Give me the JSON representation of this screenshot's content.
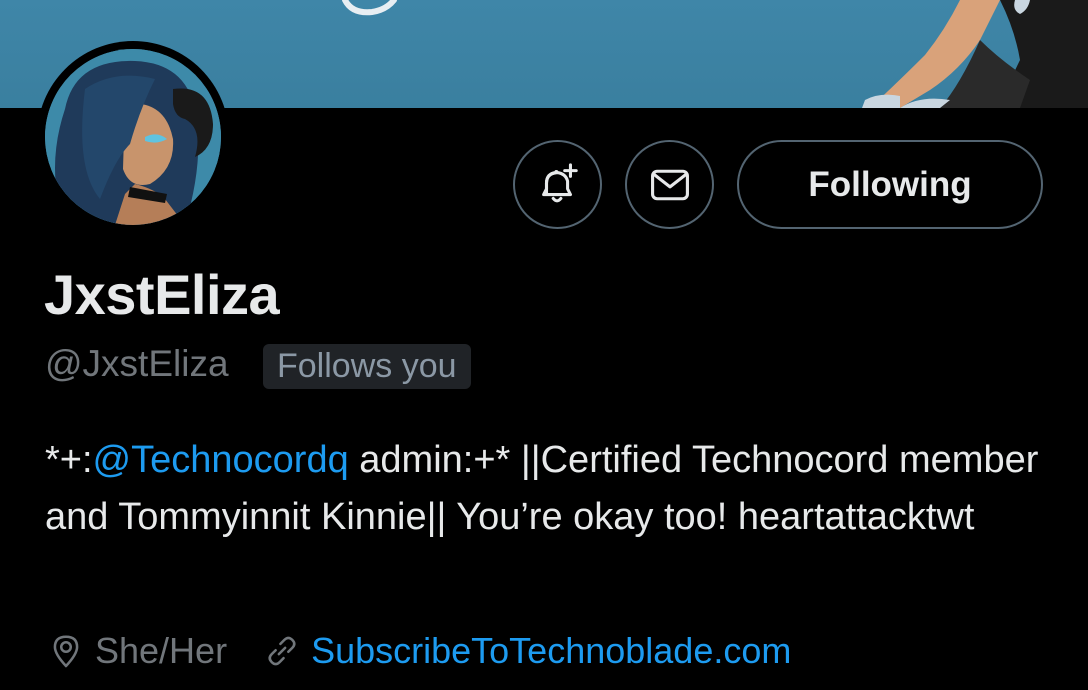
{
  "profile": {
    "display_name": "JxstEliza",
    "handle": "@JxstEliza",
    "follows_you_badge": "Follows you",
    "bio": {
      "prefix": "*+:",
      "mention": "@Technocordq",
      "rest": " admin:+* ||Certified Technocord member and Tommyinnit Kinnie|| You’re okay too! heartattacktwt"
    },
    "pronouns": "She/Her",
    "website": "SubscribeToTechnoblade.com"
  },
  "actions": {
    "following_label": "Following"
  },
  "icons": {
    "notify": "bell-plus-icon",
    "message": "envelope-icon",
    "location": "location-pin-icon",
    "link": "link-icon"
  },
  "colors": {
    "background": "#000000",
    "banner": "#3f86a8",
    "accent_link": "#1d9bf0",
    "secondary_text": "#71767b",
    "border": "#536471"
  }
}
